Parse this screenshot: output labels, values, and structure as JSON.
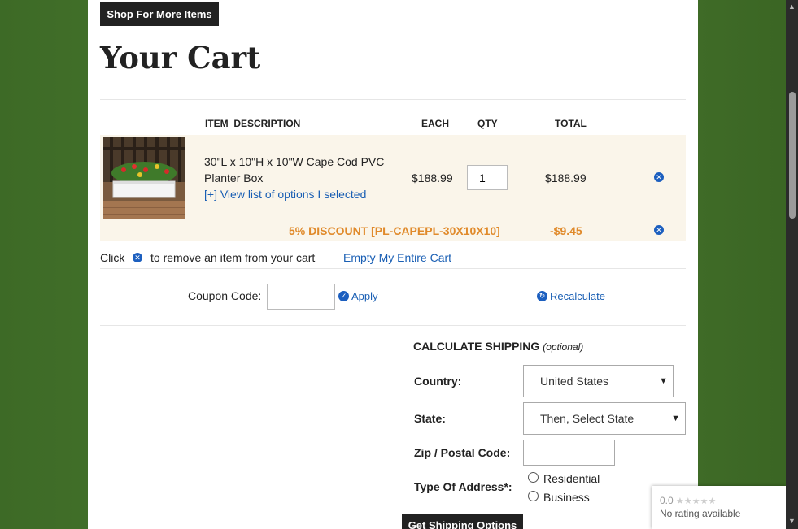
{
  "header": {
    "shop_button": "Shop For More Items",
    "title": "Your Cart"
  },
  "table": {
    "headers": [
      "ITEM  DESCRIPTION",
      "EACH",
      "QTY",
      "TOTAL"
    ]
  },
  "item": {
    "name_line1": "30\"L x 10\"H x 10\"W Cape Cod PVC",
    "name_line2": "Planter Box",
    "options_link": "[+] View list of options I selected",
    "each": "$188.99",
    "qty": "1",
    "total": "$188.99"
  },
  "discount": {
    "label": "5% DISCOUNT [PL-CAPEPL-30X10X10]",
    "amount": "-$9.45"
  },
  "cart_actions": {
    "click_text": "Click",
    "remove_text": "to remove an item from your cart",
    "empty_cart": "Empty My Entire Cart"
  },
  "coupon": {
    "label": "Coupon Code:",
    "apply": "Apply",
    "recalculate": "Recalculate"
  },
  "shipping": {
    "heading": "CALCULATE SHIPPING",
    "optional": "(optional)",
    "country_label": "Country:",
    "country_value": "United States",
    "state_label": "State:",
    "state_value": "Then, Select State",
    "zip_label": "Zip / Postal Code:",
    "address_type_label": "Type Of Address*:",
    "residential": "Residential",
    "business": "Business",
    "get_options_button": "Get Shipping Options"
  },
  "rating_widget": {
    "score": "0.0",
    "stars": "★★★★★",
    "text": "No rating available"
  },
  "colors": {
    "accent_blue": "#1c5fbf",
    "discount_orange": "#e08a2b",
    "row_bg": "#faf5ea",
    "background_green": "#4e7d33"
  }
}
